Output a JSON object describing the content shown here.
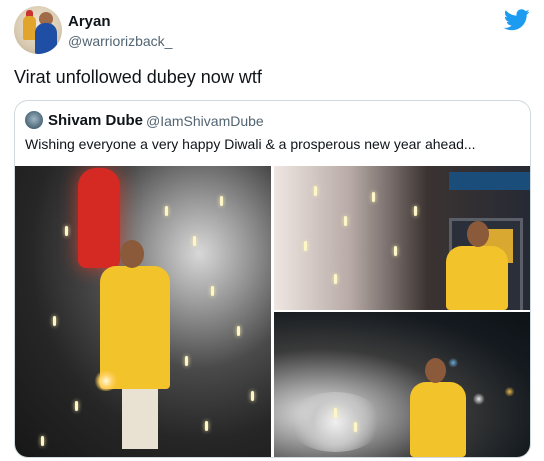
{
  "tweet": {
    "author_name": "Aryan",
    "author_handle": "@warriorizback_",
    "text": "Virat unfollowed dubey now wtf"
  },
  "quoted_tweet": {
    "author_name": "Shivam Dube",
    "author_handle": "@IamShivamDube",
    "text": "Wishing everyone a very happy Diwali & a prosperous new year ahead..."
  },
  "icons": {
    "platform": "twitter-bird-icon",
    "brand_color": "#1d9bf0"
  }
}
